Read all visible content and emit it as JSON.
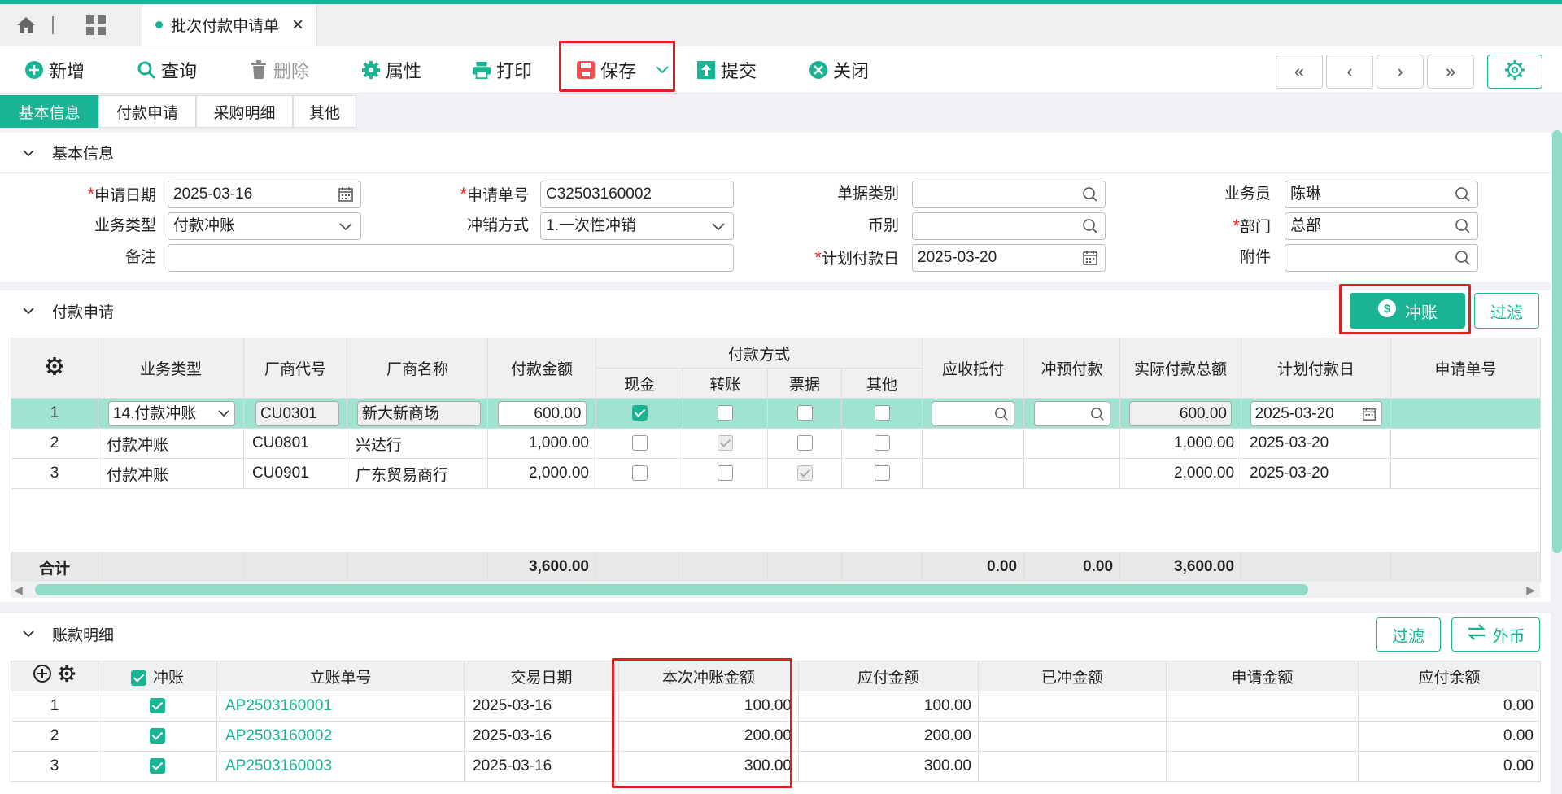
{
  "tabbar": {
    "home_icon": "home-icon",
    "grid_icon": "grid-icon",
    "doc_tab": "批次付款申请单",
    "close": "×"
  },
  "toolbar": {
    "add": "新增",
    "query": "查询",
    "delete": "删除",
    "props": "属性",
    "print": "打印",
    "save": "保存",
    "submit": "提交",
    "close": "关闭",
    "nav_first": "«",
    "nav_prev": "‹",
    "nav_next": "›",
    "nav_last": "»"
  },
  "subtabs": [
    "基本信息",
    "付款申请",
    "采购明细",
    "其他"
  ],
  "basic": {
    "section_title": "基本信息",
    "apply_date_label": "申请日期",
    "apply_date": "2025-03-16",
    "apply_no_label": "申请单号",
    "apply_no": "C32503160002",
    "doc_type_label": "单据类别",
    "doc_type": "",
    "clerk_label": "业务员",
    "clerk": "陈琳",
    "biz_type_label": "业务类型",
    "biz_type": "付款冲账",
    "writeoff_label": "冲销方式",
    "writeoff": "1.一次性冲销",
    "currency_label": "币别",
    "currency": "",
    "dept_label": "部门",
    "dept": "总部",
    "remark_label": "备注",
    "remark": "",
    "plan_date_label": "计划付款日",
    "plan_date": "2025-03-20",
    "attach_label": "附件",
    "attach": ""
  },
  "payreq": {
    "section_title": "付款申请",
    "writeoff_btn": "冲账",
    "filter_btn": "过滤",
    "headers": {
      "biz_type": "业务类型",
      "vendor_code": "厂商代号",
      "vendor_name": "厂商名称",
      "amount": "付款金额",
      "pay_method": "付款方式",
      "cash": "现金",
      "transfer": "转账",
      "bill": "票据",
      "other": "其他",
      "recv_offset": "应收抵付",
      "prepay": "冲预付款",
      "actual_total": "实际付款总额",
      "plan_date": "计划付款日",
      "apply_no": "申请单号"
    },
    "rows": [
      {
        "no": "1",
        "biz_type": "14.付款冲账",
        "vendor_code": "CU0301",
        "vendor_name": "新大新商场",
        "amount": "600.00",
        "cash": true,
        "transfer": false,
        "bill": false,
        "other": false,
        "recv_offset": "",
        "prepay": "",
        "actual_total": "600.00",
        "plan_date": "2025-03-20",
        "apply_no": ""
      },
      {
        "no": "2",
        "biz_type": "付款冲账",
        "vendor_code": "CU0801",
        "vendor_name": "兴达行",
        "amount": "1,000.00",
        "cash": false,
        "transfer": true,
        "bill": false,
        "other": false,
        "recv_offset": "",
        "prepay": "",
        "actual_total": "1,000.00",
        "plan_date": "2025-03-20",
        "apply_no": ""
      },
      {
        "no": "3",
        "biz_type": "付款冲账",
        "vendor_code": "CU0901",
        "vendor_name": "广东贸易商行",
        "amount": "2,000.00",
        "cash": false,
        "transfer": false,
        "bill": true,
        "other": false,
        "recv_offset": "",
        "prepay": "",
        "actual_total": "2,000.00",
        "plan_date": "2025-03-20",
        "apply_no": ""
      }
    ],
    "total_label": "合计",
    "total_amount": "3,600.00",
    "total_recv": "0.00",
    "total_prepay": "0.00",
    "total_actual": "3,600.00"
  },
  "detail": {
    "section_title": "账款明细",
    "filter_btn": "过滤",
    "fx_btn": "外币",
    "headers": {
      "writeoff": "冲账",
      "bill_no": "立账单号",
      "trade_date": "交易日期",
      "this_amount": "本次冲账金额",
      "payable": "应付金额",
      "written": "已冲金额",
      "applied": "申请金额",
      "balance": "应付余额"
    },
    "rows": [
      {
        "no": "1",
        "checked": true,
        "bill_no": "AP2503160001",
        "trade_date": "2025-03-16",
        "this_amount": "100.00",
        "payable": "100.00",
        "written": "",
        "applied": "",
        "balance": "0.00"
      },
      {
        "no": "2",
        "checked": true,
        "bill_no": "AP2503160002",
        "trade_date": "2025-03-16",
        "this_amount": "200.00",
        "payable": "200.00",
        "written": "",
        "applied": "",
        "balance": "0.00"
      },
      {
        "no": "3",
        "checked": true,
        "bill_no": "AP2503160003",
        "trade_date": "2025-03-16",
        "this_amount": "300.00",
        "payable": "300.00",
        "written": "",
        "applied": "",
        "balance": "0.00"
      }
    ]
  },
  "colors": {
    "accent": "#1ab394",
    "highlight": "#e02020",
    "row_selected": "#9fe3d0"
  }
}
